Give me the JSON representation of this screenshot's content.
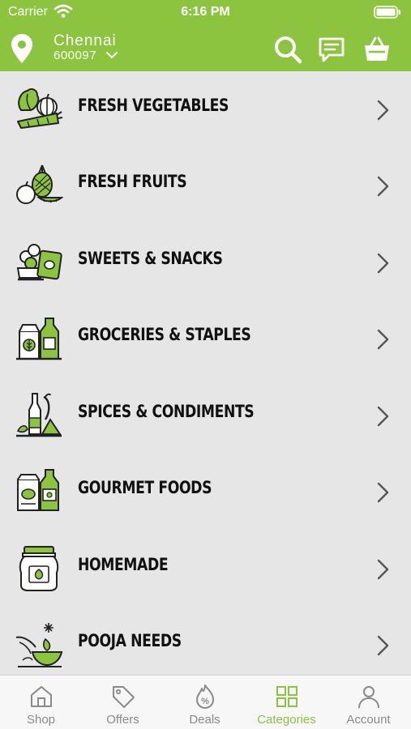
{
  "status_bar": {
    "carrier": "Carrier",
    "time": "6:16 PM"
  },
  "header": {
    "city": "Chennai",
    "pincode": "600097"
  },
  "categories": [
    {
      "label": "FRESH VEGETABLES",
      "icon": "vegetables-icon"
    },
    {
      "label": "FRESH FRUITS",
      "icon": "fruits-icon"
    },
    {
      "label": "SWEETS & SNACKS",
      "icon": "sweets-icon"
    },
    {
      "label": "GROCERIES & STAPLES",
      "icon": "groceries-icon"
    },
    {
      "label": "SPICES & CONDIMENTS",
      "icon": "spices-icon"
    },
    {
      "label": "GOURMET FOODS",
      "icon": "gourmet-icon"
    },
    {
      "label": "HOMEMADE",
      "icon": "homemade-jar-icon"
    },
    {
      "label": "POOJA NEEDS",
      "icon": "pooja-lamp-icon"
    }
  ],
  "tabs": [
    {
      "label": "Shop",
      "icon": "home-icon",
      "active": false
    },
    {
      "label": "Offers",
      "icon": "tag-icon",
      "active": false
    },
    {
      "label": "Deals",
      "icon": "percent-icon",
      "active": false
    },
    {
      "label": "Categories",
      "icon": "grid-icon",
      "active": true
    },
    {
      "label": "Account",
      "icon": "user-icon",
      "active": false
    }
  ],
  "colors": {
    "brand_green": "#8cc43f",
    "list_bg": "#e6e6e6",
    "tab_inactive": "#8a8a8a"
  }
}
